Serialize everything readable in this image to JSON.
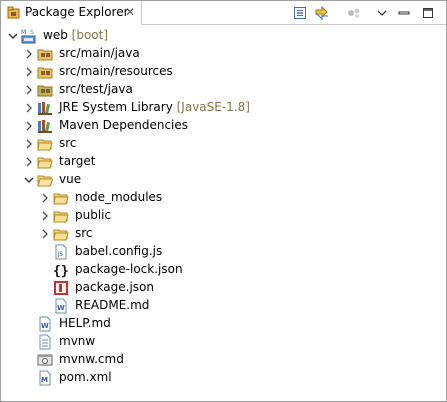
{
  "tab": {
    "title": "Package Explorer",
    "close": "✕"
  },
  "toolbar": {
    "collapse_icon": "collapse-all-icon",
    "link_icon": "link-with-editor-icon",
    "focus_icon": "focus-task-icon",
    "menu_icon": "view-menu-icon",
    "minimize_icon": "minimize-icon",
    "maximize_icon": "maximize-icon"
  },
  "tree": {
    "project": {
      "label": "web",
      "decoration": "[boot]"
    },
    "items": [
      {
        "label": "src/main/java",
        "decoration": ""
      },
      {
        "label": "src/main/resources",
        "decoration": ""
      },
      {
        "label": "src/test/java",
        "decoration": ""
      },
      {
        "label": "JRE System Library",
        "decoration": "[JavaSE-1.8]"
      },
      {
        "label": "Maven Dependencies",
        "decoration": ""
      },
      {
        "label": "src",
        "decoration": ""
      },
      {
        "label": "target",
        "decoration": ""
      },
      {
        "label": "vue",
        "decoration": ""
      },
      {
        "label": "node_modules",
        "decoration": ""
      },
      {
        "label": "public",
        "decoration": ""
      },
      {
        "label": "src",
        "decoration": ""
      },
      {
        "label": "babel.config.js",
        "decoration": ""
      },
      {
        "label": "package-lock.json",
        "decoration": ""
      },
      {
        "label": "package.json",
        "decoration": ""
      },
      {
        "label": "README.md",
        "decoration": ""
      },
      {
        "label": "HELP.md",
        "decoration": ""
      },
      {
        "label": "mvnw",
        "decoration": ""
      },
      {
        "label": "mvnw.cmd",
        "decoration": ""
      },
      {
        "label": "pom.xml",
        "decoration": ""
      }
    ]
  },
  "colors": {
    "folder": "#e9c46a",
    "package_folder": "#c98b2e",
    "selection": "#cce8ff"
  }
}
